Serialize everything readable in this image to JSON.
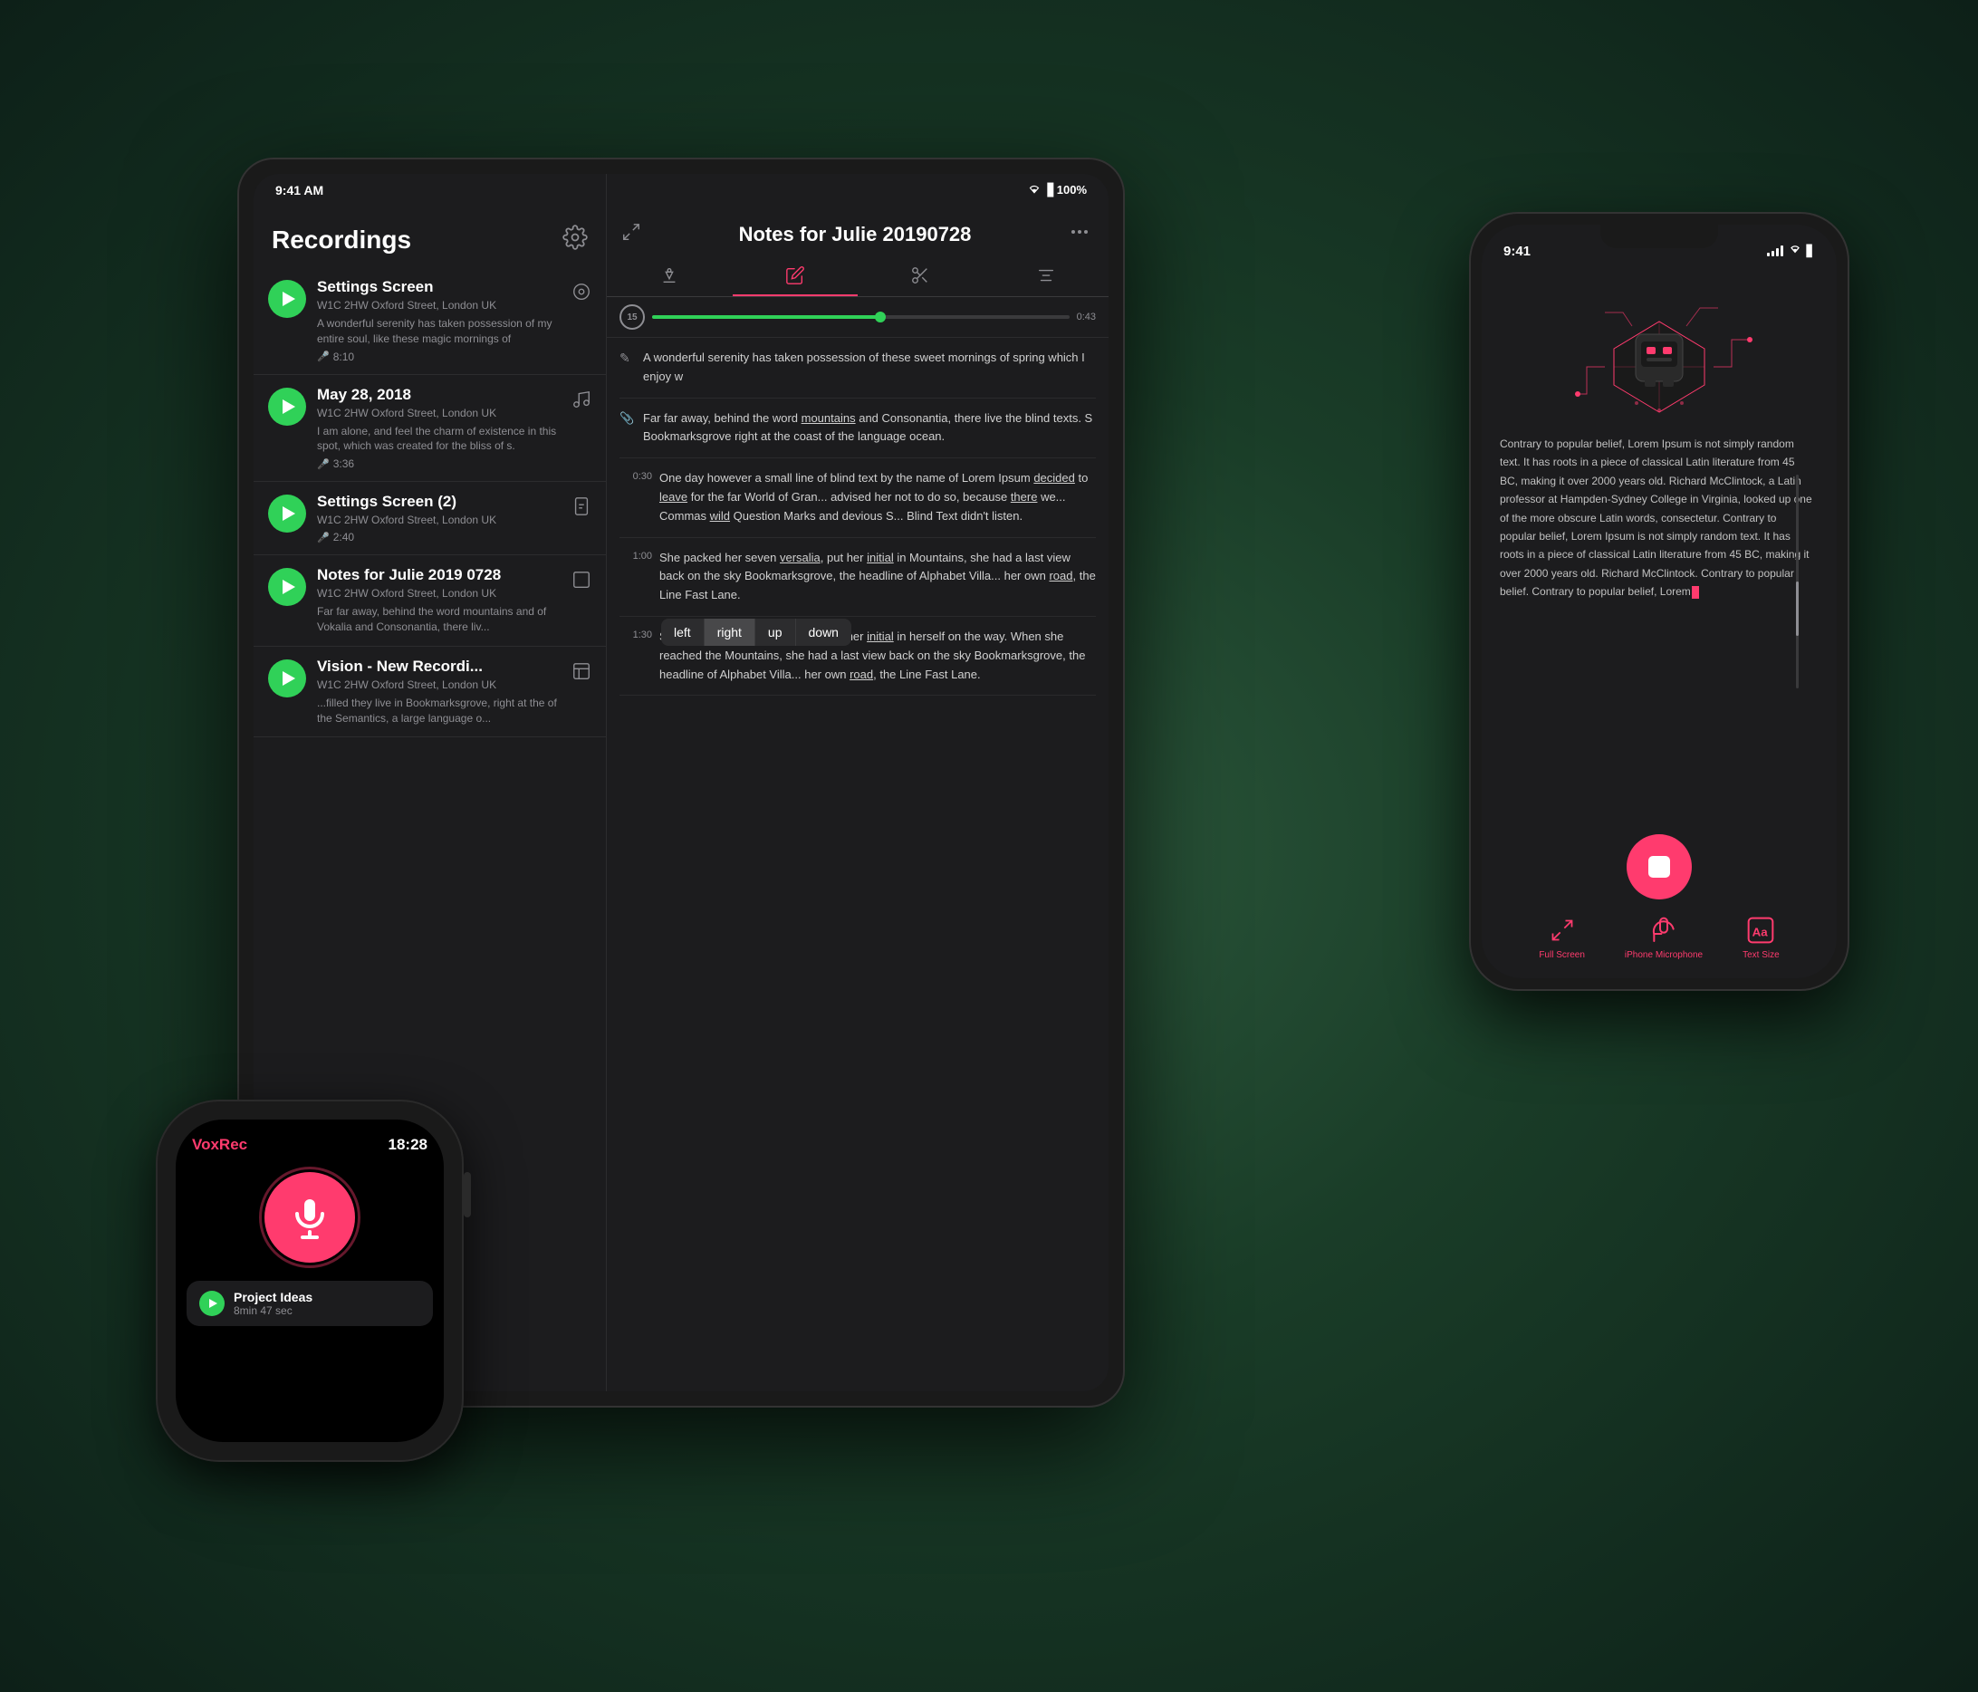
{
  "ipad": {
    "statusbar": {
      "time": "9:41 AM",
      "wifi": "WiFi",
      "battery": "100%"
    },
    "left_panel": {
      "title": "Recordings",
      "items": [
        {
          "title": "Settings Screen",
          "location": "W1C 2HW Oxford Street, London UK",
          "preview": "A wonderful serenity has taken possession of my entire soul, like these magic mornings of",
          "duration": "8:10",
          "meta_icon": "⊙"
        },
        {
          "title": "May 28, 2018",
          "location": "W1C 2HW Oxford Street, London UK",
          "preview": "I am alone, and feel the charm of existence in this spot, which was created for the bliss of s.",
          "duration": "3:36",
          "meta_icon": "♪"
        },
        {
          "title": "Settings Screen (2)",
          "location": "W1C 2HW Oxford Street, London UK",
          "preview": "",
          "duration": "2:40",
          "meta_icon": "⌚"
        },
        {
          "title": "Notes for Julie 2019 0728",
          "location": "W1C 2HW Oxford Street, London UK",
          "preview": "Far far away, behind the word mountains and of Vokalia and Consonantia, there liv...",
          "duration": "",
          "meta_icon": ""
        },
        {
          "title": "Vision - New Recordi...",
          "location": "W1C 2HW Oxford Street, London UK",
          "preview": "...filled they live in Bookmarksgrove, right at the of the Semantics, a large language o...",
          "duration": "",
          "meta_icon": "⊡"
        }
      ]
    },
    "right_panel": {
      "title": "Notes for Julie 20190728",
      "tabs": [
        "transcript",
        "edit",
        "cut",
        "settings"
      ],
      "audio_time": "0:43",
      "transcript_blocks": [
        {
          "icon": "✎",
          "timestamp": "",
          "text": "A wonderful serenity has taken possession of these sweet mornings of spring which I enjoy w"
        },
        {
          "icon": "📎",
          "timestamp": "",
          "text": "Far far away, behind the word mountains and Consonantia, there live the blind texts. S Bookmarksgrove right at the coast of the language ocean."
        },
        {
          "icon": "",
          "timestamp": "0:30",
          "text": "One day however a small line of blind text by the name of Lorem Ipsum decided to leave for the far World of Gran... advised her not to do so, because there we... Commas wild Question Marks and devious S... Blind Text didn't listen."
        },
        {
          "icon": "",
          "timestamp": "1:00",
          "text": "She packed her seven versalia, put her initial in Mountains, she had a last view back on the sky Bookmarksgrove, the headline of Alphabet Villa... her own road, the Line Fast Lane."
        },
        {
          "icon": "",
          "timestamp": "1:30",
          "text": "She packed her seven versalia, put her initial in herself on the way. When she reached the Mountains, she had a last view back on the sky Bookmarksgrove, the headline of Alphabet Villa... her own road, the Line Fast Lane."
        }
      ],
      "context_menu": [
        "left",
        "right",
        "up",
        "down"
      ]
    }
  },
  "iphone": {
    "statusbar": {
      "time": "9:41",
      "battery": "100%"
    },
    "body_text": "Contrary to popular belief, Lorem Ipsum is not simply random text. It has roots in a piece of classical Latin literature from 45 BC, making it over 2000 years old. Richard McClintock, a Latin professor at Hampden-Sydney College in Virginia, looked up one of the more obscure Latin words, consectetur. Contrary to popular belief, Lorem Ipsum is not simply random text. It has roots in a piece of classical Latin literature from 45 BC, making it over 2000 years old. Richard McClintock. Contrary to popular belief. Contrary to popular belief, Lorem",
    "bottom_actions": [
      {
        "label": "Full Screen",
        "icon": "expand"
      },
      {
        "label": "iPhone Microphone",
        "icon": "mic-refresh"
      },
      {
        "label": "Text Size",
        "icon": "text-size"
      }
    ]
  },
  "watch": {
    "app_name": "VoxRec",
    "time": "18:28",
    "recording_item": {
      "title": "Project Ideas",
      "duration": "8min 47 sec"
    }
  }
}
